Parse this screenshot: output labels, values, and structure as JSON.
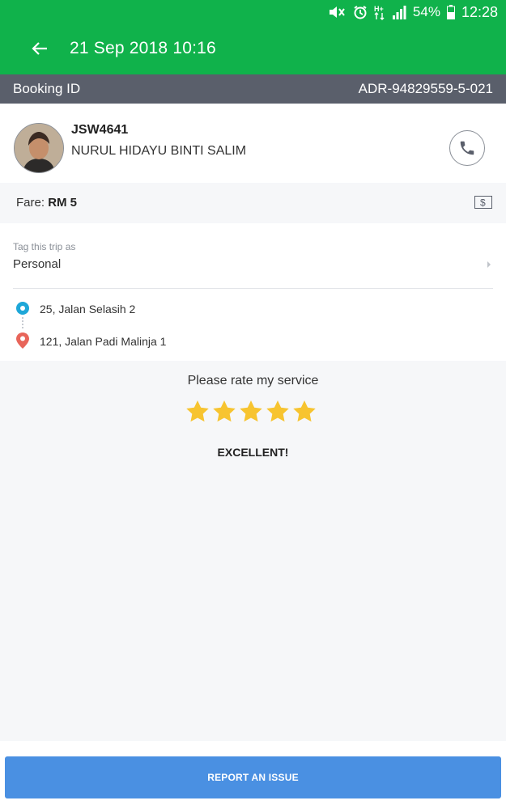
{
  "status_bar": {
    "battery": "54%",
    "time": "12:28",
    "icons": [
      "mute-icon",
      "alarm-icon",
      "network-icon",
      "signal-icon",
      "battery-icon"
    ]
  },
  "header": {
    "title": "21 Sep 2018 10:16",
    "back_icon": "arrow-left-icon",
    "color": "#10b24b"
  },
  "booking": {
    "label": "Booking ID",
    "id": "ADR-94829559-5-021"
  },
  "driver": {
    "plate": "JSW4641",
    "name": "NURUL HIDAYU BINTI SALIM",
    "call_icon": "phone-icon"
  },
  "fare": {
    "label": "Fare:",
    "amount": "RM 5",
    "icon": "cash-icon"
  },
  "trip": {
    "tag_label": "Tag this trip as",
    "tag_value": "Personal",
    "pickup": "25, Jalan Selasih 2",
    "dropoff": "121, Jalan Padi Malinja 1"
  },
  "rating": {
    "prompt": "Please rate my service",
    "stars": 5,
    "max_stars": 5,
    "result": "EXCELLENT!",
    "star_color": "#f7c430"
  },
  "actions": {
    "report": "REPORT AN ISSUE",
    "report_color": "#4a90e2"
  }
}
